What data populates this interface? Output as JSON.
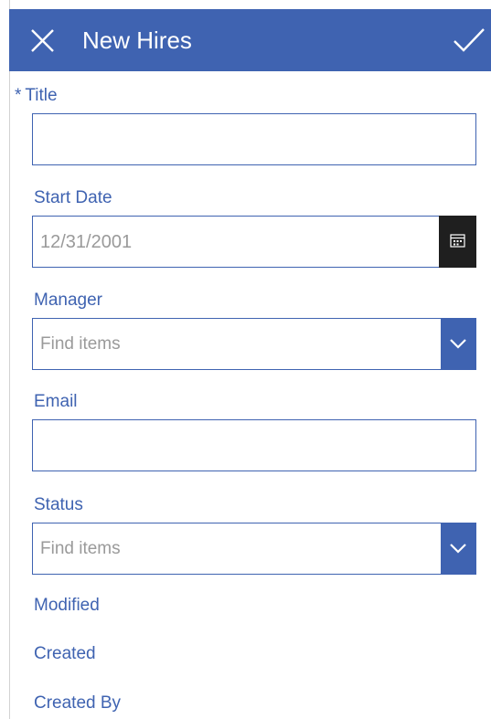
{
  "header": {
    "title": "New Hires"
  },
  "form": {
    "title_field": {
      "required_mark": "*",
      "label": "Title",
      "value": ""
    },
    "start_date": {
      "label": "Start Date",
      "value": "12/31/2001"
    },
    "manager": {
      "label": "Manager",
      "placeholder": "Find items"
    },
    "email": {
      "label": "Email",
      "value": ""
    },
    "status": {
      "label": "Status",
      "placeholder": "Find items"
    },
    "modified_label": "Modified",
    "created_label": "Created",
    "created_by_label": "Created By"
  },
  "colors": {
    "accent": "#3f63b1",
    "calendar_button": "#1f1f1f",
    "placeholder": "#9a9a9a"
  },
  "icons": {
    "close": "close-icon",
    "save": "checkmark-icon",
    "calendar": "calendar-icon",
    "dropdown": "chevron-down-icon"
  }
}
